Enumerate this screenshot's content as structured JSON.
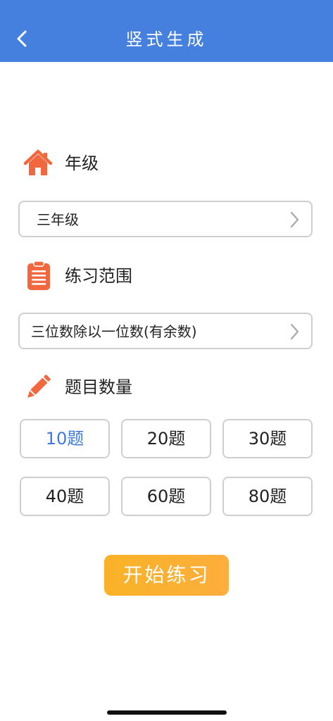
{
  "header": {
    "title": "竖式生成",
    "background_color": "#4580DE",
    "back_icon": "chevron-left-icon"
  },
  "grade": {
    "label": "年级",
    "icon": "home-icon",
    "value": "三年级"
  },
  "range": {
    "label": "练习范围",
    "icon": "clipboard-icon",
    "value": "三位数除以一位数(有余数)"
  },
  "count": {
    "label": "题目数量",
    "icon": "pencil-icon",
    "options": [
      "10题",
      "20题",
      "30题",
      "40题",
      "60题",
      "80题"
    ],
    "selected": "10题"
  },
  "start_button": {
    "label": "开始练习",
    "color": "#FAAE2C"
  },
  "accent_color": "#3E7BDA",
  "icon_color": "#F2673E"
}
